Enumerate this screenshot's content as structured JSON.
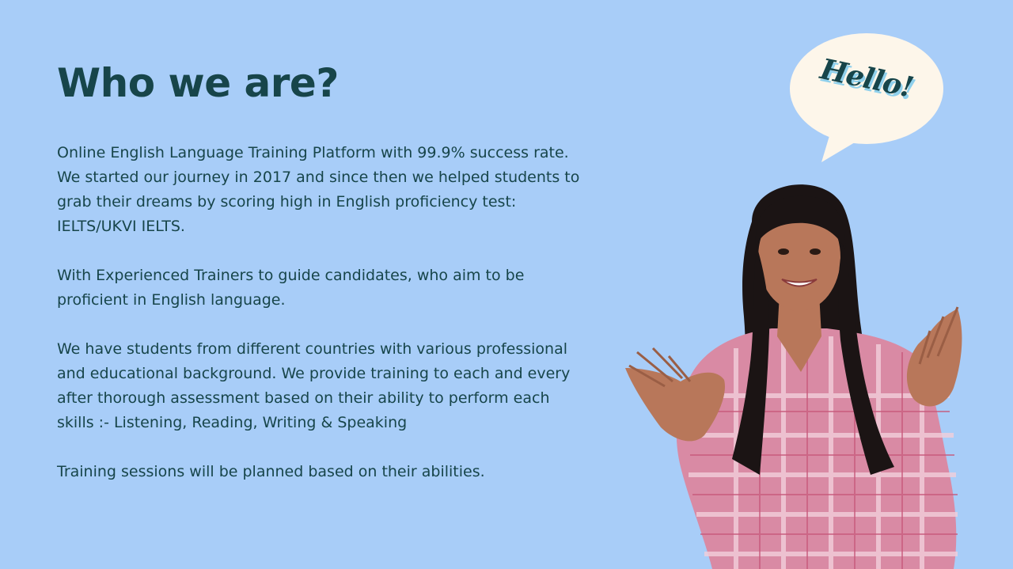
{
  "slide": {
    "title": "Who we are?",
    "paragraphs": [
      "Online English Language Training Platform with 99.9% success rate.\nWe started our journey in 2017 and since then we helped students to\ngrab their dreams by scoring high in English proficiency test:\nIELTS/UKVI IELTS.",
      "With Experienced Trainers to guide candidates, who aim to be\nproficient in English language.",
      "We have students from different countries with various professional\nand educational background. We provide training to each and every\nafter thorough assessment based on their ability to perform each\nskills :- Listening, Reading, Writing & Speaking",
      "Training sessions will be planned based on their abilities."
    ]
  },
  "bubble": {
    "text": "Hello!"
  },
  "colors": {
    "background": "#a8cdf8",
    "text": "#17454a",
    "bubble_fill": "#fdf6ea",
    "bubble_shadow": "#8fd0ec",
    "shirt": "#d98aa4",
    "hair": "#1b1414",
    "skin": "#b8775a"
  },
  "icons": {
    "bubble": "speech-bubble-icon",
    "person": "person-illustration"
  }
}
